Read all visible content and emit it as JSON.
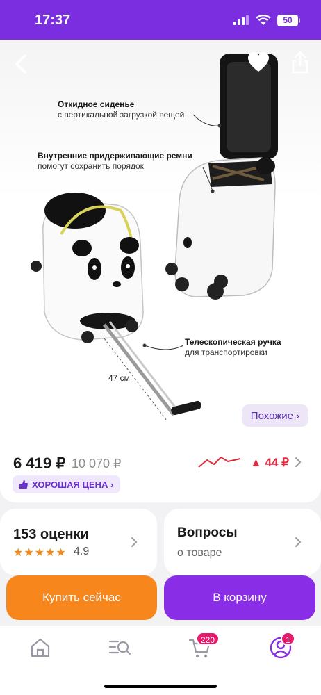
{
  "status_bar": {
    "time": "17:37",
    "battery": "50"
  },
  "gallery": {
    "callouts": [
      {
        "title": "Откидное сиденье",
        "text": "с вертикальной загрузкой вещей"
      },
      {
        "title": "Внутренние придерживающие ремни",
        "text": "помогут сохранить порядок"
      },
      {
        "title": "Телескопическая ручка",
        "text": "для транспортировки"
      }
    ],
    "dimension_label": "47 см",
    "similar_label": "Похожие ›"
  },
  "price": {
    "current": "6 419 ₽",
    "old": "10 070 ₽",
    "change": "▲ 44 ₽",
    "badge_label": "ХОРОШАЯ ЦЕНА ›"
  },
  "ratings": {
    "title": "153 оценки",
    "stars": "★★★★★",
    "value": "4.9"
  },
  "questions": {
    "title": "Вопросы",
    "subtitle": "о товаре"
  },
  "actions": {
    "buy_now": "Купить сейчас",
    "add_to_cart": "В корзину"
  },
  "tab_bar": {
    "items": [
      {
        "icon": "home-icon"
      },
      {
        "icon": "catalog-search-icon"
      },
      {
        "icon": "cart-icon",
        "badge": "220"
      },
      {
        "icon": "profile-icon",
        "badge": "1"
      }
    ]
  },
  "colors": {
    "brand": "#7b2ee0",
    "buy": "#f7861c",
    "cart": "#8a2de6",
    "price_up": "#e22a3b"
  }
}
